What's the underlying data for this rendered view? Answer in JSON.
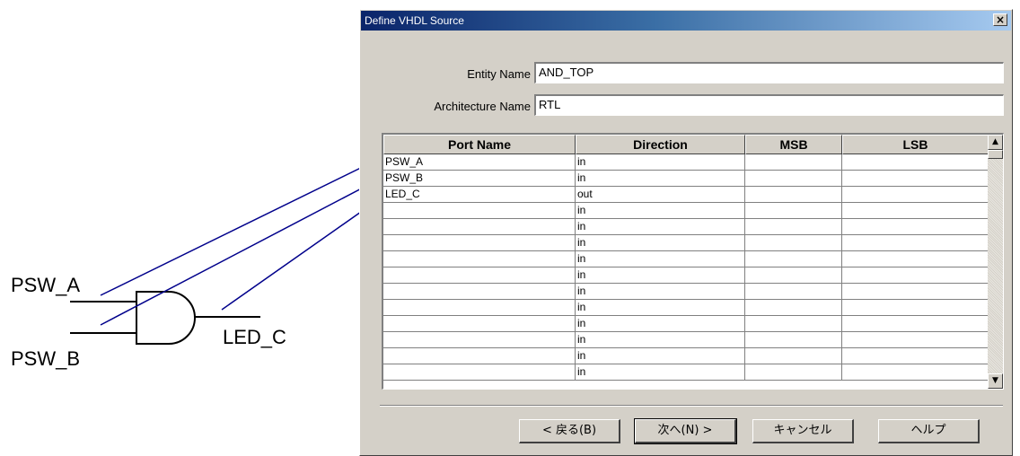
{
  "diagram": {
    "input_a_label": "PSW_A",
    "input_b_label": "PSW_B",
    "output_label": "LED_C",
    "arrow_color": "#00008b"
  },
  "dialog": {
    "title": "Define VHDL Source",
    "close_glyph": "×",
    "entity_label": "Entity Name",
    "entity_value": "AND_TOP",
    "architecture_label": "Architecture Name",
    "architecture_value": "RTL",
    "columns": [
      "Port Name",
      "Direction",
      "MSB",
      "LSB"
    ],
    "rows": [
      {
        "name": "PSW_A",
        "dir": "in",
        "msb": "",
        "lsb": ""
      },
      {
        "name": "PSW_B",
        "dir": "in",
        "msb": "",
        "lsb": ""
      },
      {
        "name": "LED_C",
        "dir": "out",
        "msb": "",
        "lsb": ""
      },
      {
        "name": "",
        "dir": "in",
        "msb": "",
        "lsb": ""
      },
      {
        "name": "",
        "dir": "in",
        "msb": "",
        "lsb": ""
      },
      {
        "name": "",
        "dir": "in",
        "msb": "",
        "lsb": ""
      },
      {
        "name": "",
        "dir": "in",
        "msb": "",
        "lsb": ""
      },
      {
        "name": "",
        "dir": "in",
        "msb": "",
        "lsb": ""
      },
      {
        "name": "",
        "dir": "in",
        "msb": "",
        "lsb": ""
      },
      {
        "name": "",
        "dir": "in",
        "msb": "",
        "lsb": ""
      },
      {
        "name": "",
        "dir": "in",
        "msb": "",
        "lsb": ""
      },
      {
        "name": "",
        "dir": "in",
        "msb": "",
        "lsb": ""
      },
      {
        "name": "",
        "dir": "in",
        "msb": "",
        "lsb": ""
      },
      {
        "name": "",
        "dir": "in",
        "msb": "",
        "lsb": ""
      }
    ],
    "scroll_up_glyph": "▲",
    "scroll_down_glyph": "▼",
    "buttons": {
      "back": "< 戻る(B)",
      "next": "次へ(N) >",
      "cancel": "キャンセル",
      "help": "ヘルプ"
    }
  }
}
